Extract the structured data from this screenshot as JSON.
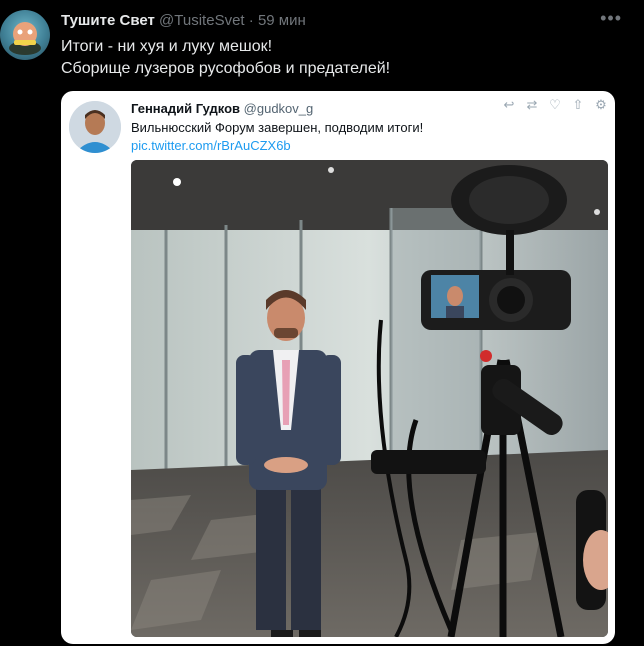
{
  "tweet": {
    "display_name": "Тушите Свет",
    "handle": "@TusiteSvet",
    "separator": "·",
    "time": "59 мин",
    "more_label": "•••",
    "lines": [
      "Итоги - ни хуя и луку мешок!",
      "Сборище лузеров русофобов и предателей!"
    ]
  },
  "quoted_tweet": {
    "display_name": "Геннадий Гудков",
    "handle": "@gudkov_g",
    "text": "Вильнюсский Форум завершен, подводим итоги!",
    "link": "pic.twitter.com/rBrAuCZX6b",
    "actions": [
      {
        "name": "reply-icon",
        "glyph": "↩"
      },
      {
        "name": "retweet-icon",
        "glyph": "⇄"
      },
      {
        "name": "like-icon",
        "glyph": "♡"
      },
      {
        "name": "share-icon",
        "glyph": "⇧"
      },
      {
        "name": "settings-icon",
        "glyph": "⚙"
      }
    ]
  },
  "colors": {
    "background": "#000000",
    "link": "#1d9bf0",
    "muted": "#71767b"
  }
}
